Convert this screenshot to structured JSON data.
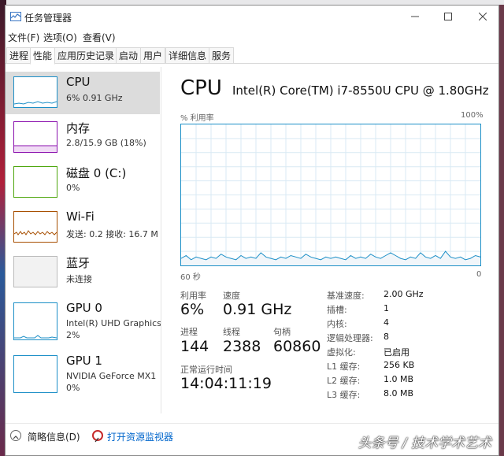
{
  "window": {
    "title": "任务管理器"
  },
  "menu": [
    "文件(F)",
    "选项(O)",
    "查看(V)"
  ],
  "tabs": [
    "进程",
    "性能",
    "应用历史记录",
    "启动",
    "用户",
    "详细信息",
    "服务"
  ],
  "sidebar": {
    "cpu": {
      "name": "CPU",
      "detail": "6% 0.91 GHz"
    },
    "mem": {
      "name": "内存",
      "detail": "2.8/15.9 GB (18%)"
    },
    "disk": {
      "name": "磁盘 0 (C:)",
      "detail": "0%"
    },
    "wifi": {
      "name": "Wi-Fi",
      "detail": "发送: 0.2 接收: 16.7 M"
    },
    "bt": {
      "name": "蓝牙",
      "detail": "未连接"
    },
    "gpu0": {
      "name": "GPU 0",
      "detail1": "Intel(R) UHD Graphics",
      "detail2": "2%"
    },
    "gpu1": {
      "name": "GPU 1",
      "detail1": "NVIDIA GeForce MX1",
      "detail2": "0%"
    }
  },
  "main": {
    "title": "CPU",
    "model": "Intel(R) Core(TM) i7-8550U CPU @ 1.80GHz",
    "graph_ylabel": "% 利用率",
    "graph_ymax": "100%",
    "graph_xleft": "60 秒",
    "graph_xright": "0"
  },
  "chart_data": {
    "type": "area",
    "xlabel": "60 秒",
    "ylabel": "% 利用率",
    "ylim": [
      0,
      100
    ],
    "x_range_seconds": [
      60,
      0
    ],
    "values": [
      5,
      7,
      4,
      6,
      5,
      4,
      6,
      5,
      8,
      6,
      5,
      4,
      7,
      5,
      6,
      5,
      9,
      6,
      5,
      4,
      6,
      5,
      7,
      6,
      5,
      8,
      6,
      5,
      4,
      6,
      5,
      6,
      5,
      4,
      7,
      5,
      6,
      5,
      8,
      6,
      5,
      7,
      9,
      7,
      5,
      4,
      6,
      5,
      9,
      6,
      5,
      7,
      5,
      10,
      6,
      5,
      6,
      4,
      5,
      7,
      6
    ]
  },
  "stats": {
    "util_label": "利用率",
    "util_value": "6%",
    "speed_label": "速度",
    "speed_value": "0.91 GHz",
    "proc_label": "进程",
    "proc_value": "144",
    "thread_label": "线程",
    "thread_value": "2388",
    "handle_label": "句柄",
    "handle_value": "60860",
    "uptime_label": "正常运行时间",
    "uptime_value": "14:04:11:19"
  },
  "info": [
    {
      "label": "基准速度:",
      "value": "2.00 GHz"
    },
    {
      "label": "插槽:",
      "value": "1"
    },
    {
      "label": "内核:",
      "value": "4"
    },
    {
      "label": "逻辑处理器:",
      "value": "8"
    },
    {
      "label": "虚拟化:",
      "value": "已启用"
    },
    {
      "label": "L1 缓存:",
      "value": "256 KB"
    },
    {
      "label": "L2 缓存:",
      "value": "1.0 MB"
    },
    {
      "label": "L3 缓存:",
      "value": "8.0 MB"
    }
  ],
  "footer": {
    "brief": "简略信息(D)",
    "monitor": "打开资源监视器"
  },
  "watermark": "头条号 / 技术学术艺术",
  "colors": {
    "cpu": "#1c8fc7",
    "mem": "#8b12ae",
    "disk": "#4da60c",
    "wifi": "#a74f01",
    "bt": "#bbbbbb",
    "gpu": "#1c8fc7",
    "link": "#0066cc"
  }
}
